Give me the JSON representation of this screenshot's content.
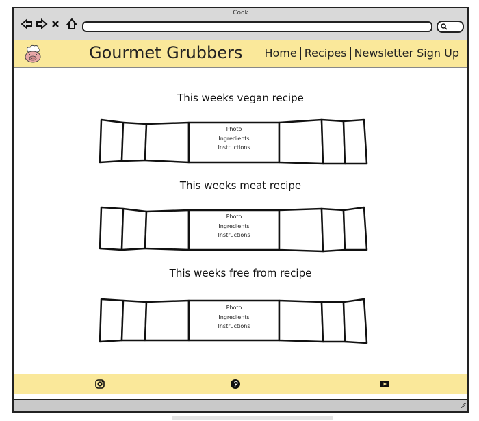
{
  "window": {
    "title": "Cook"
  },
  "header": {
    "site_title": "Gourmet Grubbers",
    "nav": [
      "Home",
      "Recipes",
      "Newsletter Sign Up"
    ]
  },
  "sections": [
    {
      "title": "This weeks vegan recipe",
      "card": [
        "Photo",
        "Ingredients",
        "Instructions"
      ]
    },
    {
      "title": "This weeks meat recipe",
      "card": [
        "Photo",
        "Ingredients",
        "Instructions"
      ]
    },
    {
      "title": "This weeks free from recipe",
      "card": [
        "Photo",
        "Ingredients",
        "Instructions"
      ]
    }
  ],
  "footer": {
    "icons": [
      "instagram-icon",
      "pinterest-icon",
      "youtube-icon"
    ]
  },
  "colors": {
    "header_bg": "#fae89a",
    "chrome_bg": "#d9d9d9"
  }
}
